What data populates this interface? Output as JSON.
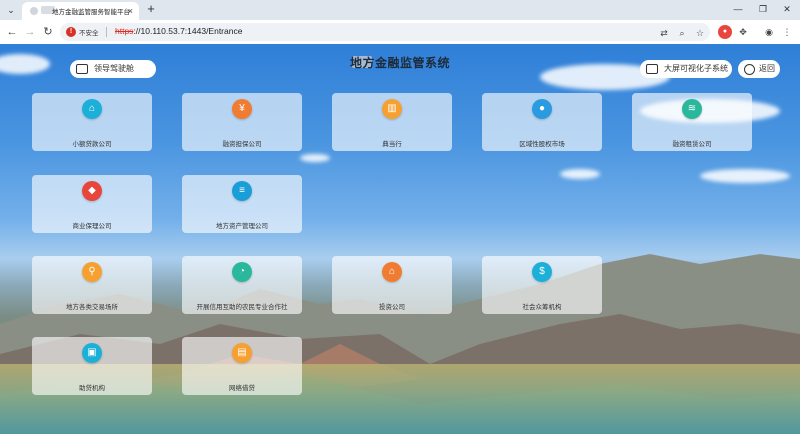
{
  "browser": {
    "tab_title": "地方金融监管服务智能平台",
    "tab_close": "×",
    "new_tab": "+",
    "security_label": "不安全",
    "url_scheme": "https",
    "url_rest": "://10.110.53.7:1443/Entrance",
    "window": {
      "minimize": "—",
      "maximize": "❐",
      "close": "✕"
    }
  },
  "header": {
    "left_button": "领导驾驶舱",
    "title": "地方金融监管系统",
    "right_button": "大屏可视化子系统",
    "back_button": "返回"
  },
  "cards": [
    {
      "label": "小额贷款公司",
      "color": "#1cb0d8",
      "icon": "house-icon",
      "glyph": "⌂"
    },
    {
      "label": "融资担保公司",
      "color": "#f07c32",
      "icon": "guarantee-icon",
      "glyph": "¥"
    },
    {
      "label": "典当行",
      "color": "#f5a030",
      "icon": "pawnshop-icon",
      "glyph": "▥"
    },
    {
      "label": "区域性股权市场",
      "color": "#2a9be0",
      "icon": "people-icon",
      "glyph": "●"
    },
    {
      "label": "融资租赁公司",
      "color": "#2ab89c",
      "icon": "layers-icon",
      "glyph": "≋"
    },
    {
      "label": "商业保理公司",
      "color": "#e8453c",
      "icon": "shield-icon",
      "glyph": "◆"
    },
    {
      "label": "地方资产管理公司",
      "color": "#1a9ed8",
      "icon": "asset-icon",
      "glyph": "≡"
    },
    {
      "label": "地方各类交易场所",
      "color": "#f5a030",
      "icon": "search-person-icon",
      "glyph": "⚲"
    },
    {
      "label": "开展信用互助的农民专业合作社",
      "color": "#2ab89c",
      "icon": "pie-chart-icon",
      "glyph": "◔"
    },
    {
      "label": "投资公司",
      "color": "#f07c32",
      "icon": "home-icon",
      "glyph": "⌂"
    },
    {
      "label": "社会众筹机构",
      "color": "#1cb0d8",
      "icon": "money-bag-icon",
      "glyph": "$"
    },
    {
      "label": "助贷机构",
      "color": "#1cb0d8",
      "icon": "camera-icon",
      "glyph": "▣"
    },
    {
      "label": "网络借贷",
      "color": "#f5a030",
      "icon": "clipboard-icon",
      "glyph": "▤"
    }
  ]
}
